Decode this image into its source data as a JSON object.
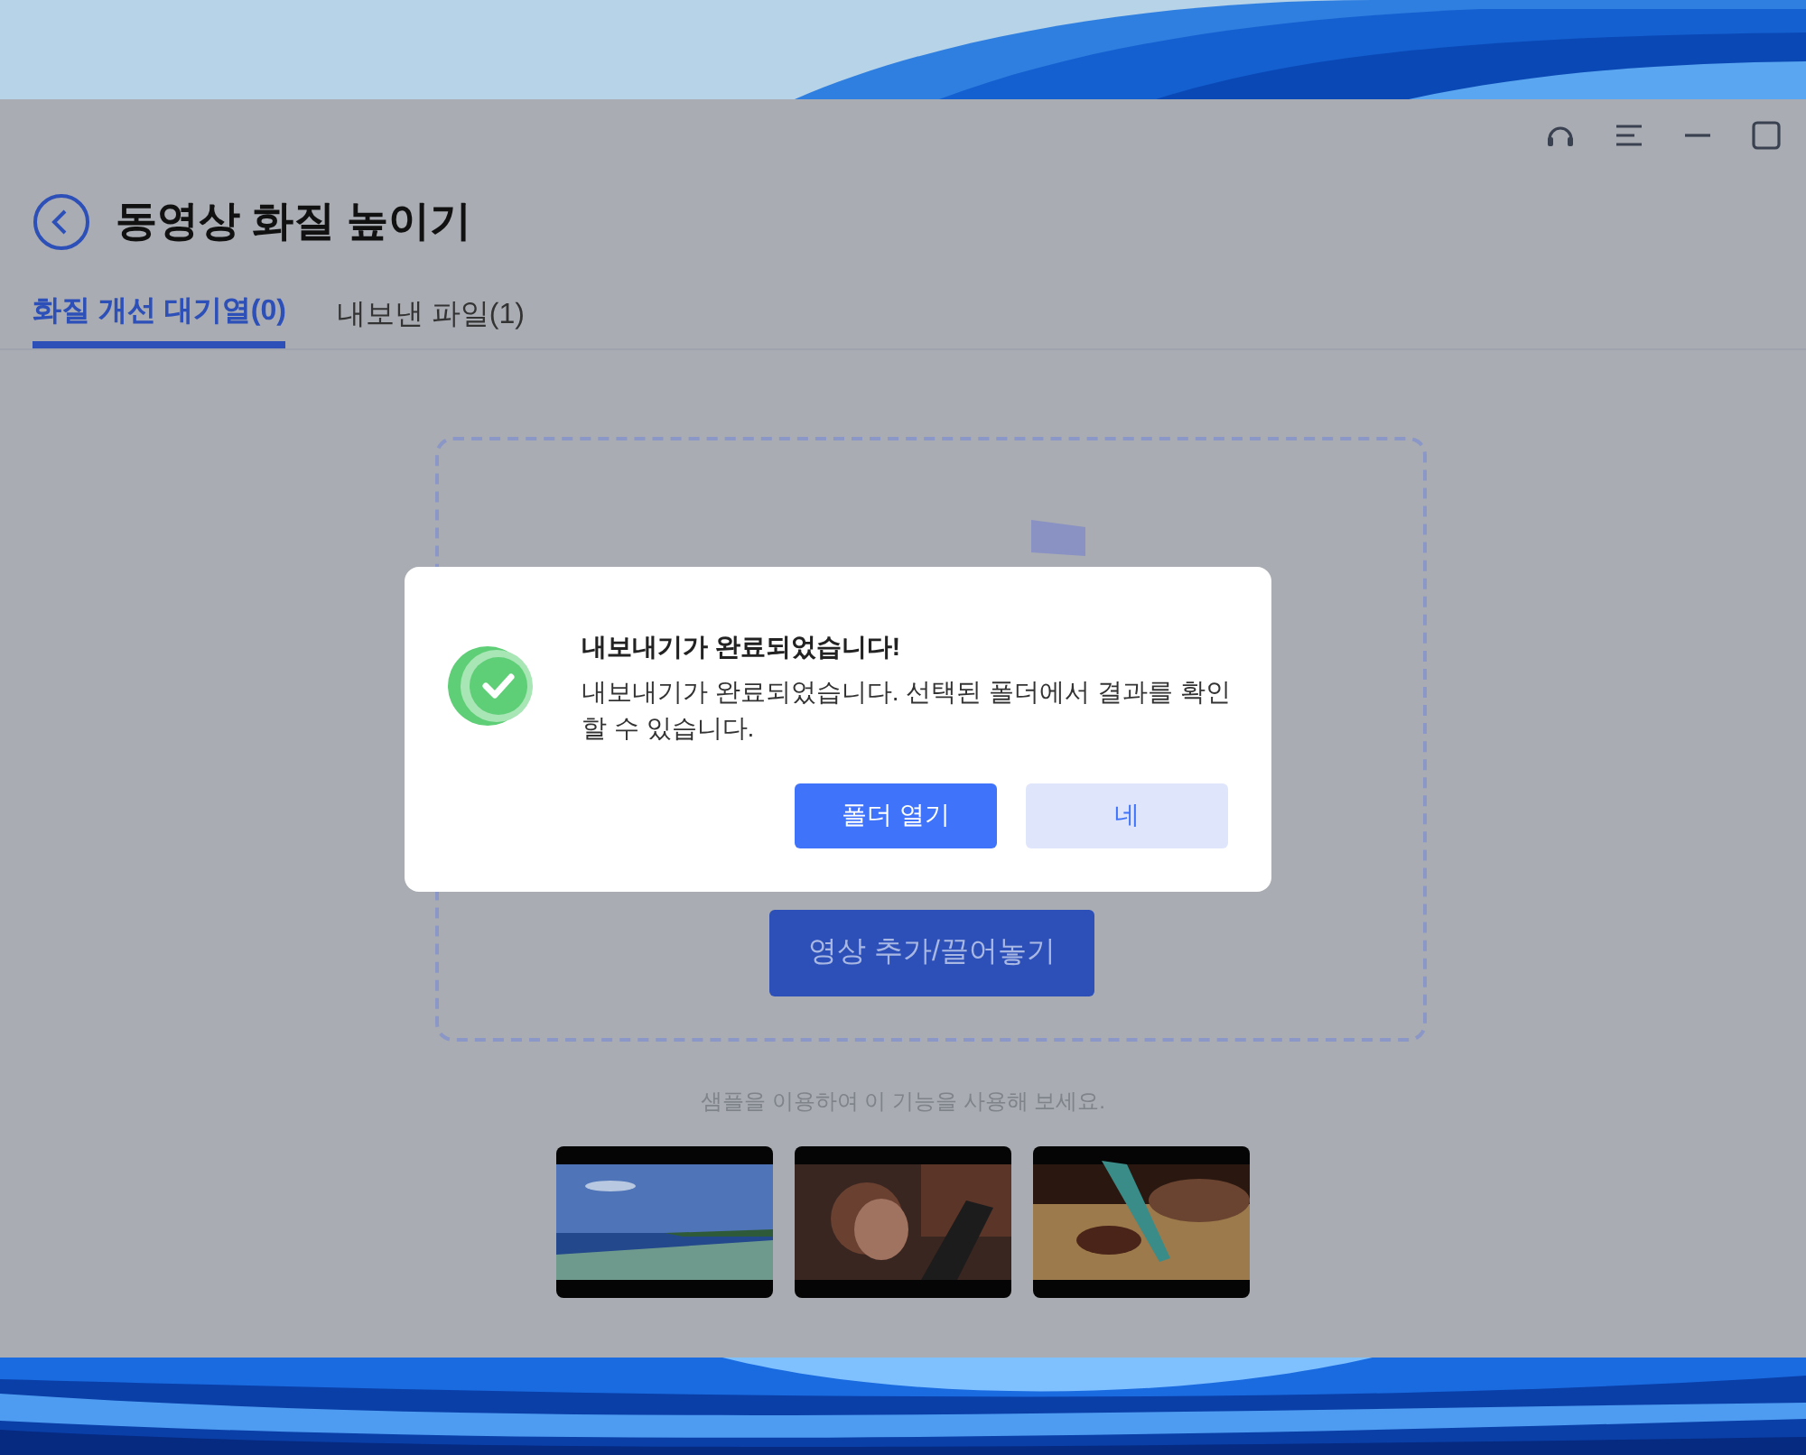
{
  "window": {
    "controls": [
      {
        "kind": "support"
      },
      {
        "kind": "menu"
      },
      {
        "kind": "minimize"
      },
      {
        "kind": "maximize"
      }
    ]
  },
  "page": {
    "title": "동영상 화질 높이기"
  },
  "tabs": [
    {
      "label": "화질 개선 대기열(0)",
      "selected": true
    },
    {
      "label": "내보낸 파일(1)",
      "selected": false
    }
  ],
  "dropzone": {
    "button": "영상 추가/끌어놓기"
  },
  "samples": {
    "hint": "샘플을 이용하여 이 기능을 사용해 보세요."
  },
  "dialog": {
    "title": "내보내기가 완료되었습니다!",
    "message": "내보내기가 완료되었습니다. 선택된 폴더에서 결과를 확인할 수 있습니다.",
    "buttons": [
      {
        "label": "폴더 열기",
        "kind": "primary"
      },
      {
        "label": "네",
        "kind": "secondary"
      }
    ]
  }
}
